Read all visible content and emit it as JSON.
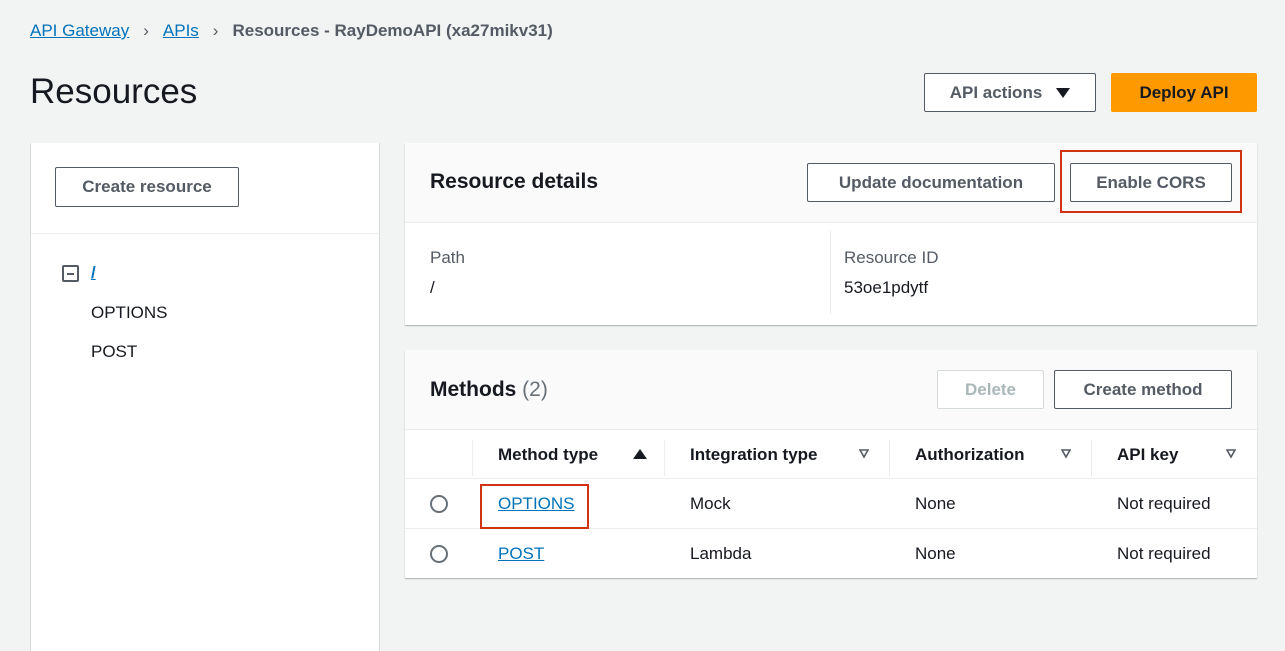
{
  "breadcrumb": {
    "items": [
      "API Gateway",
      "APIs"
    ],
    "current": "Resources - RayDemoAPI (xa27mikv31)",
    "separator": "›"
  },
  "page": {
    "title": "Resources",
    "api_actions_label": "API actions",
    "deploy_label": "Deploy API"
  },
  "left_panel": {
    "create_resource_label": "Create resource",
    "tree": {
      "root": "/",
      "methods": [
        "OPTIONS",
        "POST"
      ]
    }
  },
  "resource_details": {
    "title": "Resource details",
    "update_doc_label": "Update documentation",
    "enable_cors_label": "Enable CORS",
    "path_label": "Path",
    "path_value": "/",
    "resource_id_label": "Resource ID",
    "resource_id_value": "53oe1pdytf"
  },
  "methods": {
    "title": "Methods",
    "count": "(2)",
    "delete_label": "Delete",
    "create_method_label": "Create method",
    "columns": [
      "Method type",
      "Integration type",
      "Authorization",
      "API key"
    ],
    "rows": [
      {
        "method": "OPTIONS",
        "integration": "Mock",
        "auth": "None",
        "api_key": "Not required"
      },
      {
        "method": "POST",
        "integration": "Lambda",
        "auth": "None",
        "api_key": "Not required"
      }
    ]
  },
  "colors": {
    "link": "#0073bb",
    "primary": "#ff9900",
    "highlight": "#d13212"
  }
}
